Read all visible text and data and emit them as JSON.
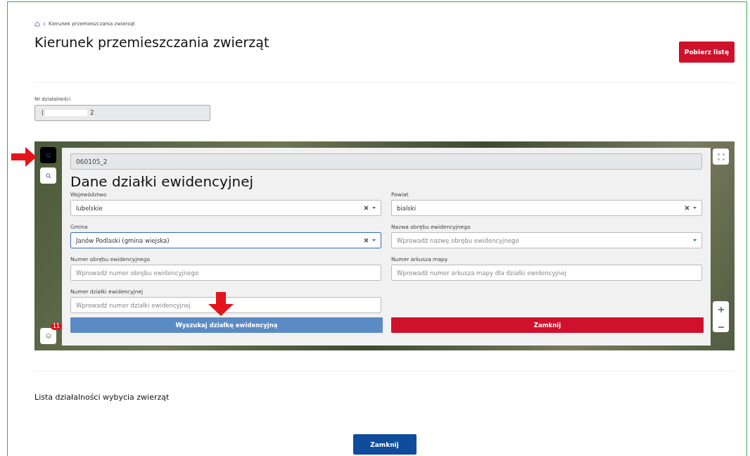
{
  "breadcrumb": {
    "current": "Kierunek przemieszczania zwierząt"
  },
  "title": "Kierunek przemieszczania zwierząt",
  "download_button": "Pobierz listę",
  "activity_number": {
    "label": "Nr działalności",
    "value_start": "(",
    "value_end": "2"
  },
  "map": {
    "layers_badge": "11",
    "panel": {
      "id_value": "060105_2",
      "heading": "Dane działki ewidencyjnej",
      "fields": [
        {
          "label": "Województwo",
          "kind": "select",
          "value": "lubelskie",
          "clearable": true,
          "focused": false
        },
        {
          "label": "Powiat",
          "kind": "select",
          "value": "bialski",
          "clearable": true,
          "focused": false
        },
        {
          "label": "Gmina",
          "kind": "select",
          "value": "Janów Podlaski (gmina wiejska)",
          "clearable": true,
          "focused": true
        },
        {
          "label": "Nazwa obrębu ewidencyjnego",
          "kind": "select",
          "placeholder": "Wprowadź nazwę obrębu ewidencyjnego",
          "clearable": false,
          "focused": false
        },
        {
          "label": "Numer obrębu ewidencyjnego",
          "kind": "text",
          "placeholder": "Wprowadź numer obrębu ewidencyjnego",
          "focused": false
        },
        {
          "label": "Numer arkusza mapy",
          "kind": "text",
          "placeholder": "Wprowadź numer arkusza mapy dla działki ewidencyjnej",
          "focused": false
        },
        {
          "label": "Numer działki ewidencyjnej",
          "kind": "text",
          "placeholder": "Wprowadź numer działki ewidencyjnej",
          "focused": false
        }
      ],
      "search_button": "Wyszukaj działkę ewidencyjną",
      "close_button": "Zamknij"
    }
  },
  "list_title": "Lista działalności wybycia zwierząt",
  "footer_button": "Zamknij"
}
